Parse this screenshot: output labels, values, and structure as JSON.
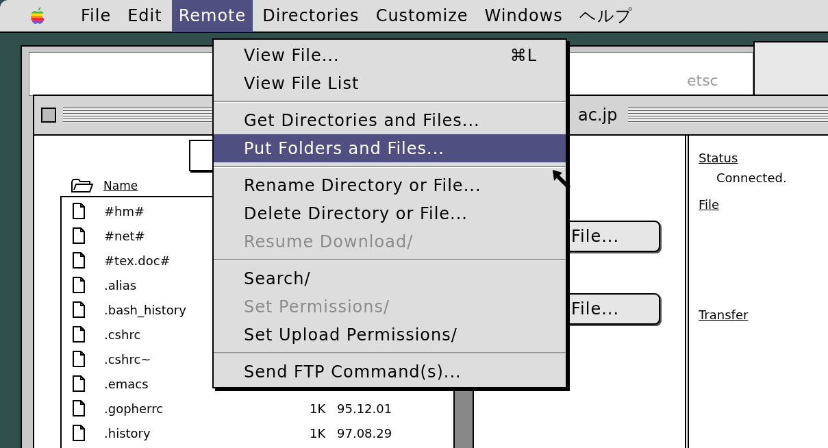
{
  "menu_bar": {
    "items": [
      {
        "label": "File",
        "selected": false
      },
      {
        "label": "Edit",
        "selected": false
      },
      {
        "label": "Remote",
        "selected": true
      },
      {
        "label": "Directories",
        "selected": false
      },
      {
        "label": "Customize",
        "selected": false
      },
      {
        "label": "Windows",
        "selected": false
      },
      {
        "label": "ヘルプ",
        "selected": false
      }
    ]
  },
  "menu": {
    "items": [
      {
        "kind": "item",
        "label": "View File...",
        "shortcut": "⌘L",
        "disabled": false,
        "selected": false
      },
      {
        "kind": "item",
        "label": "View File List",
        "disabled": false,
        "selected": false
      },
      {
        "kind": "separator"
      },
      {
        "kind": "item",
        "label": "Get Directories and Files...",
        "disabled": false,
        "selected": false
      },
      {
        "kind": "item",
        "label": "Put Folders and Files...",
        "disabled": false,
        "selected": true
      },
      {
        "kind": "separator"
      },
      {
        "kind": "item",
        "label": "Rename Directory or File...",
        "disabled": false,
        "selected": false
      },
      {
        "kind": "item",
        "label": "Delete Directory or File...",
        "disabled": false,
        "selected": false
      },
      {
        "kind": "item",
        "label": "Resume Download/",
        "disabled": true,
        "selected": false
      },
      {
        "kind": "separator"
      },
      {
        "kind": "item",
        "label": "Search/",
        "disabled": false,
        "selected": false
      },
      {
        "kind": "item",
        "label": "Set Permissions/",
        "disabled": true,
        "selected": false
      },
      {
        "kind": "item",
        "label": "Set Upload Permissions/",
        "disabled": false,
        "selected": false
      },
      {
        "kind": "separator"
      },
      {
        "kind": "item",
        "label": "Send FTP Command(s)...",
        "disabled": false,
        "selected": false
      }
    ]
  },
  "back_window": {
    "title": "etsc"
  },
  "window": {
    "title": "ac.jp",
    "file_list": {
      "column_header": "Name",
      "rows": [
        {
          "name": "#hm#"
        },
        {
          "name": "#net#"
        },
        {
          "name": "#tex.doc#"
        },
        {
          "name": ".alias"
        },
        {
          "name": ".bash_history"
        },
        {
          "name": ".cshrc"
        },
        {
          "name": ".cshrc~"
        },
        {
          "name": ".emacs"
        },
        {
          "name": ".gopherrc",
          "size": "1K",
          "date": "95.12.01"
        },
        {
          "name": ".history",
          "size": "1K",
          "date": "97.08.29"
        }
      ]
    },
    "buttons": [
      "File...",
      "File..."
    ],
    "info": {
      "status_label": "Status",
      "status": "Connected.",
      "file_label": "File",
      "transfer_label": "Transfer"
    }
  }
}
